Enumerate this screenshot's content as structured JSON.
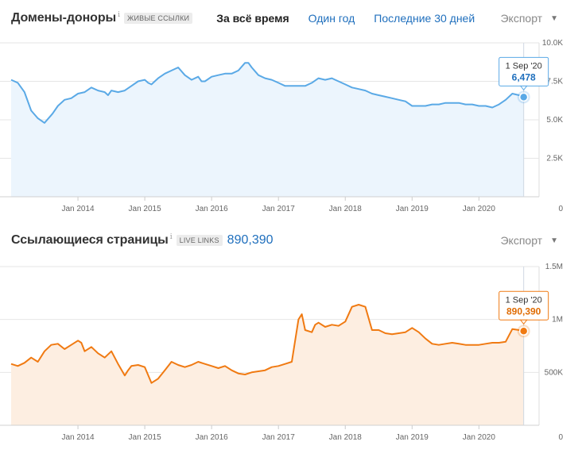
{
  "charts": [
    {
      "title": "Домены-доноры",
      "info_mark": "i",
      "badge": "ЖИВЫЕ ССЫЛКИ",
      "range_tabs": [
        {
          "label": "За всё время",
          "active": true
        },
        {
          "label": "Один год",
          "active": false
        },
        {
          "label": "Последние 30 дней",
          "active": false
        }
      ],
      "export_label": "Экспорт",
      "tooltip": {
        "date": "1 Sep '20",
        "value": "6,478"
      },
      "colors": {
        "line": "#5aa9e6",
        "fill": "#ecf5fd",
        "marker": "#5aa9e6",
        "tooltip_text": "#1f6fbd"
      }
    },
    {
      "title": "Ссылающиеся страницы",
      "info_mark": "i",
      "badge": "LIVE LINKS",
      "metric_value": "890,390",
      "export_label": "Экспорт",
      "tooltip": {
        "date": "1 Sep '20",
        "value": "890,390"
      },
      "colors": {
        "line": "#f07a12",
        "fill": "#fdeee1",
        "marker": "#f07a12",
        "tooltip_text": "#e06d05"
      }
    }
  ],
  "chart_data": [
    {
      "type": "area",
      "title": "Домены-доноры",
      "x_ticks": [
        "Jan 2014",
        "Jan 2015",
        "Jan 2016",
        "Jan 2017",
        "Jan 2018",
        "Jan 2019",
        "Jan 2020"
      ],
      "y_ticks": [
        "0",
        "2.5K",
        "5.0K",
        "7.5K",
        "10.0K"
      ],
      "ylim": [
        0,
        10000
      ],
      "xlim": [
        2013.0,
        2020.9
      ],
      "grid": true,
      "series": [
        {
          "x": [
            2013.0,
            2013.1,
            2013.2,
            2013.3,
            2013.4,
            2013.5,
            2013.6,
            2013.62,
            2013.7,
            2013.8,
            2013.9,
            2014.0,
            2014.1,
            2014.2,
            2014.3,
            2014.4,
            2014.45,
            2014.5,
            2014.6,
            2014.7,
            2014.8,
            2014.9,
            2015.0,
            2015.05,
            2015.1,
            2015.2,
            2015.3,
            2015.4,
            2015.5,
            2015.6,
            2015.7,
            2015.8,
            2015.85,
            2015.9,
            2016.0,
            2016.1,
            2016.2,
            2016.3,
            2016.4,
            2016.5,
            2016.55,
            2016.6,
            2016.7,
            2016.8,
            2016.9,
            2017.0,
            2017.1,
            2017.2,
            2017.3,
            2017.4,
            2017.5,
            2017.6,
            2017.7,
            2017.8,
            2017.85,
            2017.9,
            2018.0,
            2018.1,
            2018.2,
            2018.3,
            2018.4,
            2018.5,
            2018.6,
            2018.7,
            2018.8,
            2018.9,
            2019.0,
            2019.1,
            2019.2,
            2019.3,
            2019.4,
            2019.5,
            2019.6,
            2019.7,
            2019.8,
            2019.9,
            2020.0,
            2020.1,
            2020.2,
            2020.3,
            2020.4,
            2020.5,
            2020.6,
            2020.67
          ],
          "values": [
            7600,
            7400,
            6800,
            5600,
            5100,
            4800,
            5300,
            5400,
            5900,
            6300,
            6400,
            6700,
            6800,
            7100,
            6900,
            6800,
            6600,
            6900,
            6800,
            6900,
            7200,
            7500,
            7600,
            7400,
            7300,
            7700,
            8000,
            8200,
            8400,
            7900,
            7600,
            7800,
            7500,
            7500,
            7800,
            7900,
            8000,
            8000,
            8200,
            8700,
            8700,
            8400,
            7900,
            7700,
            7600,
            7400,
            7200,
            7200,
            7200,
            7200,
            7400,
            7700,
            7600,
            7700,
            7600,
            7500,
            7300,
            7100,
            7000,
            6900,
            6700,
            6600,
            6500,
            6400,
            6300,
            6200,
            5900,
            5900,
            5900,
            6000,
            6000,
            6100,
            6100,
            6100,
            6000,
            6000,
            5900,
            5900,
            5800,
            6000,
            6300,
            6700,
            6600,
            6478
          ]
        }
      ]
    },
    {
      "type": "area",
      "title": "Ссылающиеся страницы",
      "x_ticks": [
        "Jan 2014",
        "Jan 2015",
        "Jan 2016",
        "Jan 2017",
        "Jan 2018",
        "Jan 2019",
        "Jan 2020"
      ],
      "y_ticks": [
        "0",
        "500K",
        "1M",
        "1.5M"
      ],
      "ylim": [
        0,
        1500000
      ],
      "xlim": [
        2013.0,
        2020.9
      ],
      "grid": true,
      "series": [
        {
          "x": [
            2013.0,
            2013.1,
            2013.2,
            2013.3,
            2013.4,
            2013.5,
            2013.6,
            2013.7,
            2013.8,
            2013.9,
            2014.0,
            2014.05,
            2014.1,
            2014.2,
            2014.3,
            2014.4,
            2014.5,
            2014.6,
            2014.7,
            2014.75,
            2014.8,
            2014.9,
            2015.0,
            2015.1,
            2015.2,
            2015.3,
            2015.4,
            2015.5,
            2015.6,
            2015.7,
            2015.8,
            2015.9,
            2016.0,
            2016.1,
            2016.2,
            2016.3,
            2016.4,
            2016.5,
            2016.6,
            2016.7,
            2016.8,
            2016.9,
            2017.0,
            2017.1,
            2017.2,
            2017.3,
            2017.35,
            2017.4,
            2017.5,
            2017.55,
            2017.6,
            2017.7,
            2017.8,
            2017.9,
            2018.0,
            2018.1,
            2018.2,
            2018.3,
            2018.4,
            2018.5,
            2018.6,
            2018.7,
            2018.8,
            2018.9,
            2019.0,
            2019.1,
            2019.2,
            2019.3,
            2019.4,
            2019.5,
            2019.6,
            2019.7,
            2019.8,
            2019.9,
            2020.0,
            2020.1,
            2020.2,
            2020.3,
            2020.4,
            2020.5,
            2020.6,
            2020.67
          ],
          "values": [
            580000,
            560000,
            590000,
            640000,
            600000,
            700000,
            760000,
            770000,
            720000,
            760000,
            800000,
            780000,
            700000,
            740000,
            680000,
            640000,
            700000,
            580000,
            470000,
            520000,
            560000,
            570000,
            550000,
            400000,
            440000,
            520000,
            600000,
            570000,
            550000,
            570000,
            600000,
            580000,
            560000,
            540000,
            560000,
            520000,
            490000,
            480000,
            500000,
            510000,
            520000,
            550000,
            560000,
            580000,
            600000,
            1000000,
            1050000,
            900000,
            880000,
            950000,
            970000,
            930000,
            950000,
            940000,
            980000,
            1120000,
            1140000,
            1120000,
            900000,
            900000,
            870000,
            860000,
            870000,
            880000,
            920000,
            880000,
            820000,
            770000,
            760000,
            770000,
            780000,
            770000,
            760000,
            760000,
            760000,
            770000,
            780000,
            780000,
            790000,
            910000,
            900000,
            890390
          ]
        }
      ]
    }
  ]
}
